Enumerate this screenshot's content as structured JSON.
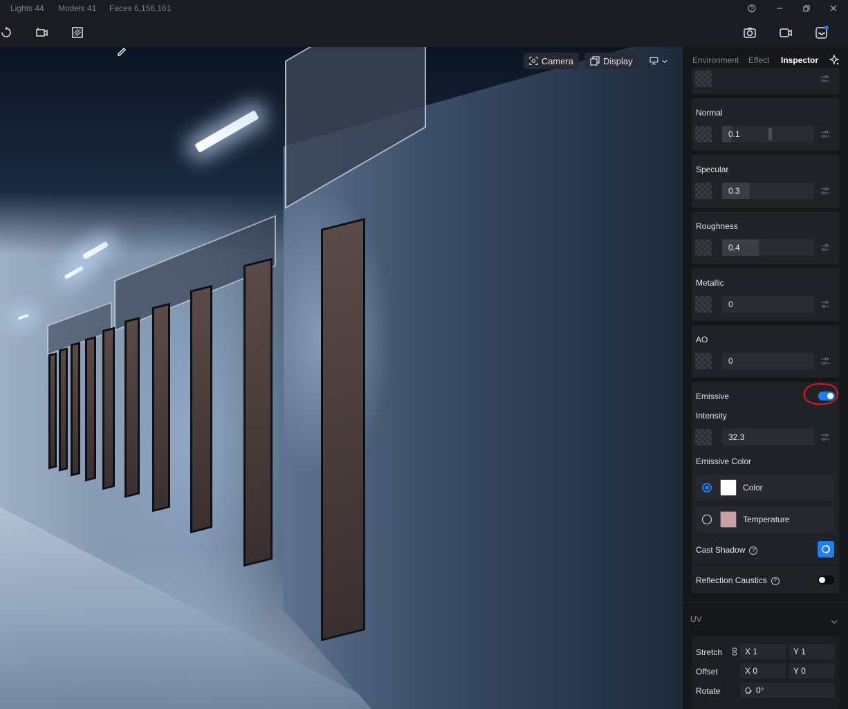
{
  "status": {
    "lights": "Lights 44",
    "models": "Models 41",
    "faces": "Faces 6,156,161"
  },
  "viewport": {
    "camera_label": "Camera",
    "display_label": "Display"
  },
  "inspector": {
    "tabs": [
      {
        "label": "Environment"
      },
      {
        "label": "Effect"
      },
      {
        "label": "Inspector"
      }
    ],
    "properties": [
      {
        "label": "Normal",
        "value": "0.1",
        "level": 0.1
      },
      {
        "label": "Specular",
        "value": "0.3",
        "level": 0.3
      },
      {
        "label": "Roughness",
        "value": "0.4",
        "level": 0.4
      },
      {
        "label": "Metallic",
        "value": "0",
        "level": 0
      },
      {
        "label": "AO",
        "value": "0",
        "level": 0
      }
    ],
    "emissive": {
      "label": "Emissive",
      "enabled": true,
      "intensity_label": "Intensity",
      "intensity_value": "32.3",
      "color_label": "Emissive Color",
      "options": [
        {
          "label": "Color",
          "selected": true,
          "swatch": "#ffffff"
        },
        {
          "label": "Temperature",
          "selected": false,
          "swatch": "#c9a1a2"
        }
      ]
    },
    "cast_shadow": {
      "label": "Cast Shadow",
      "enabled": true
    },
    "reflection_caustics": {
      "label": "Reflection Caustics",
      "enabled": false
    },
    "uv": {
      "title": "UV",
      "stretch_label": "Stretch",
      "stretch_x": "X 1",
      "stretch_y": "Y 1",
      "offset_label": "Offset",
      "offset_x": "X 0",
      "offset_y": "Y 0",
      "rotate_label": "Rotate",
      "rotate_value": "0°"
    }
  },
  "colors": {
    "accent": "#1e7ff0",
    "panel_bg": "#16171b",
    "card_bg": "#202228",
    "annotation_red": "#e8141c"
  }
}
